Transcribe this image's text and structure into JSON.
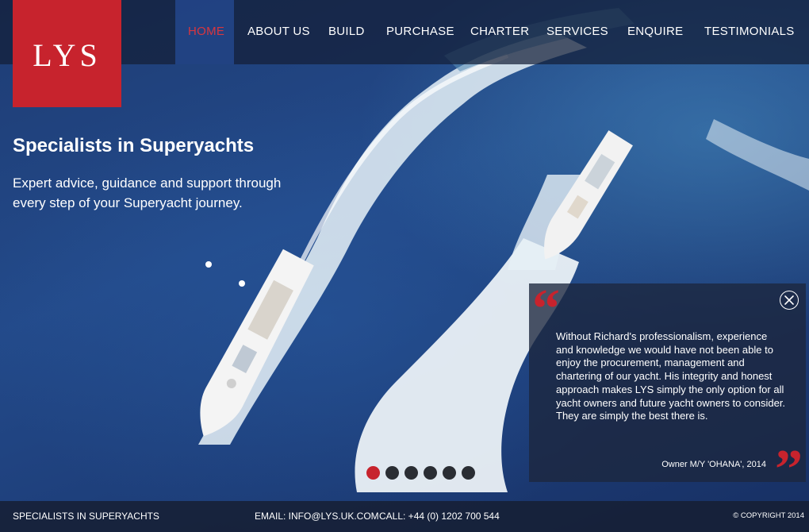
{
  "brand": {
    "logo_text": "LYS",
    "accent_color": "#c7232d"
  },
  "nav": {
    "items": [
      {
        "label": "HOME",
        "active": true
      },
      {
        "label": "ABOUT US",
        "active": false
      },
      {
        "label": "BUILD",
        "active": false
      },
      {
        "label": "PURCHASE",
        "active": false
      },
      {
        "label": "CHARTER",
        "active": false
      },
      {
        "label": "SERVICES",
        "active": false
      },
      {
        "label": "ENQUIRE",
        "active": false
      },
      {
        "label": "TESTIMONIALS",
        "active": false
      }
    ]
  },
  "hero": {
    "title": "Specialists in Superyachts",
    "subtitle": "Expert advice, guidance and support through every step of your Superyacht journey."
  },
  "testimonial": {
    "quote_open_icon": "quote-open-icon",
    "quote_close_icon": "quote-close-icon",
    "close_icon": "close-icon",
    "text": "Without Richard's professionalism, experience and knowledge we would have not been able to enjoy the procurement, management and chartering of our yacht. His integrity and honest approach makes LYS simply the only option for all yacht owners and future yacht owners to consider. They are simply the best there is.",
    "author": "Owner M/Y 'OHANA', 2014"
  },
  "slider": {
    "count": 6,
    "active_index": 0
  },
  "footer": {
    "tagline": "SPECIALISTS IN SUPERYACHTS",
    "email": "EMAIL: INFO@LYS.UK.COM",
    "call": "CALL: +44 (0) 1202 700 544",
    "copyright": "© COPYRIGHT 2014"
  }
}
